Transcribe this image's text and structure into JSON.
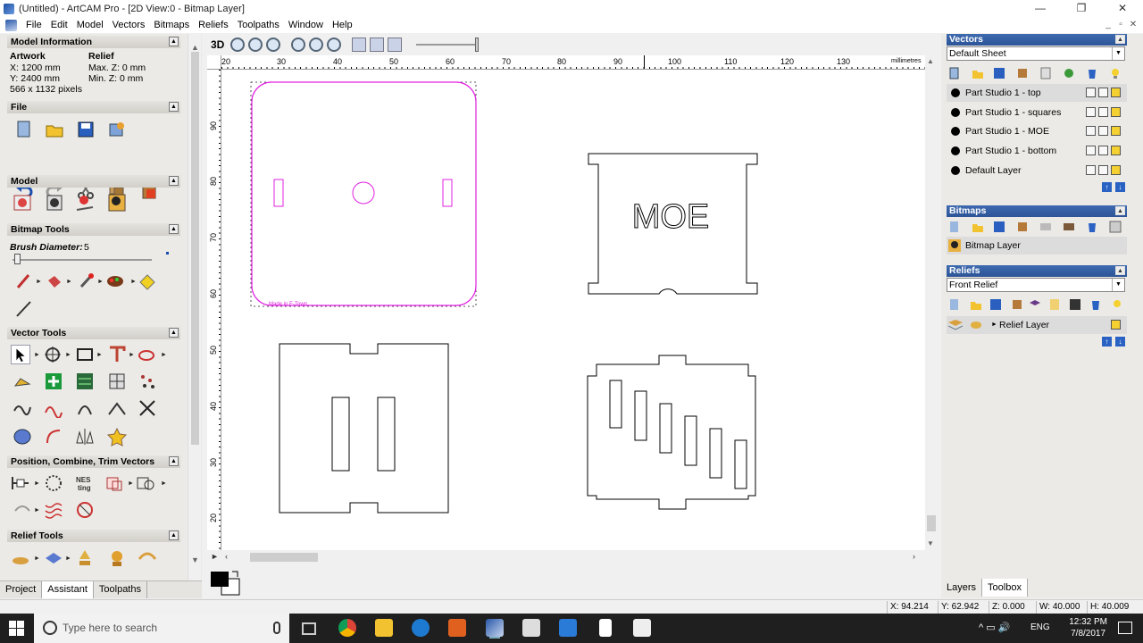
{
  "titlebar": {
    "title": "(Untitled) - ArtCAM Pro - [2D View:0 - Bitmap Layer]",
    "minimize": "—",
    "maximize": "❐",
    "close": "✕"
  },
  "menubar": {
    "items": [
      "File",
      "Edit",
      "Model",
      "Vectors",
      "Bitmaps",
      "Reliefs",
      "Toolpaths",
      "Window",
      "Help"
    ],
    "mdi": [
      "_",
      "▫",
      "✕"
    ]
  },
  "left": {
    "model_information": {
      "title": "Model Information",
      "artwork_label": "Artwork",
      "relief_label": "Relief",
      "x": "X: 1200 mm",
      "y": "Y: 2400 mm",
      "pixels": "566 x 1132 pixels",
      "max_z": "Max. Z: 0 mm",
      "min_z": "Min. Z: 0 mm"
    },
    "sections": {
      "file": "File",
      "model": "Model",
      "bitmap_tools": "Bitmap Tools",
      "vector_tools": "Vector Tools",
      "position": "Position, Combine, Trim Vectors",
      "relief_tools": "Relief Tools"
    },
    "brush_label": "Brush Diameter:",
    "brush_value": "5",
    "collapse": "▲"
  },
  "left_tabs": [
    "Project",
    "Assistant",
    "Toolpaths"
  ],
  "view_toolbar": {
    "label_3d": "3D"
  },
  "ruler": {
    "h_ticks": [
      "20",
      "30",
      "40",
      "50",
      "60",
      "70",
      "80",
      "90",
      "100",
      "110",
      "120",
      "130"
    ],
    "h_unit": "millimetres",
    "v_ticks": [
      "90",
      "80",
      "70",
      "60",
      "50",
      "40",
      "30",
      "20"
    ]
  },
  "canvas": {
    "moe_text": "MOE",
    "small_label": "Made in E-Town"
  },
  "right": {
    "vectors_title": "Vectors",
    "vectors_sheet": "Default Sheet",
    "vector_layers": [
      "Part Studio 1 - top",
      "Part Studio 1 - squares",
      "Part Studio 1 - MOE",
      "Part Studio 1 - bottom",
      "Default Layer"
    ],
    "bitmaps_title": "Bitmaps",
    "bitmap_layer": "Bitmap Layer",
    "reliefs_title": "Reliefs",
    "relief_select": "Front Relief",
    "relief_layer": "Relief Layer",
    "up": "↑",
    "down": "↓",
    "dd": "▼",
    "collapse": "▲"
  },
  "right_tabs": [
    "Layers",
    "Toolbox"
  ],
  "status": {
    "x": "X: 94.214",
    "y": "Y: 62.942",
    "z": "Z: 0.000",
    "w": "W: 40.000",
    "h": "H: 40.009"
  },
  "taskbar": {
    "search_placeholder": "Type here to search",
    "lang": "ENG",
    "time": "12:32 PM",
    "date": "7/8/2017",
    "tray_icons": "^ ▭ 🔊"
  },
  "colors": {
    "magenta": "#e020e0",
    "panel_head": "#2d5597"
  }
}
